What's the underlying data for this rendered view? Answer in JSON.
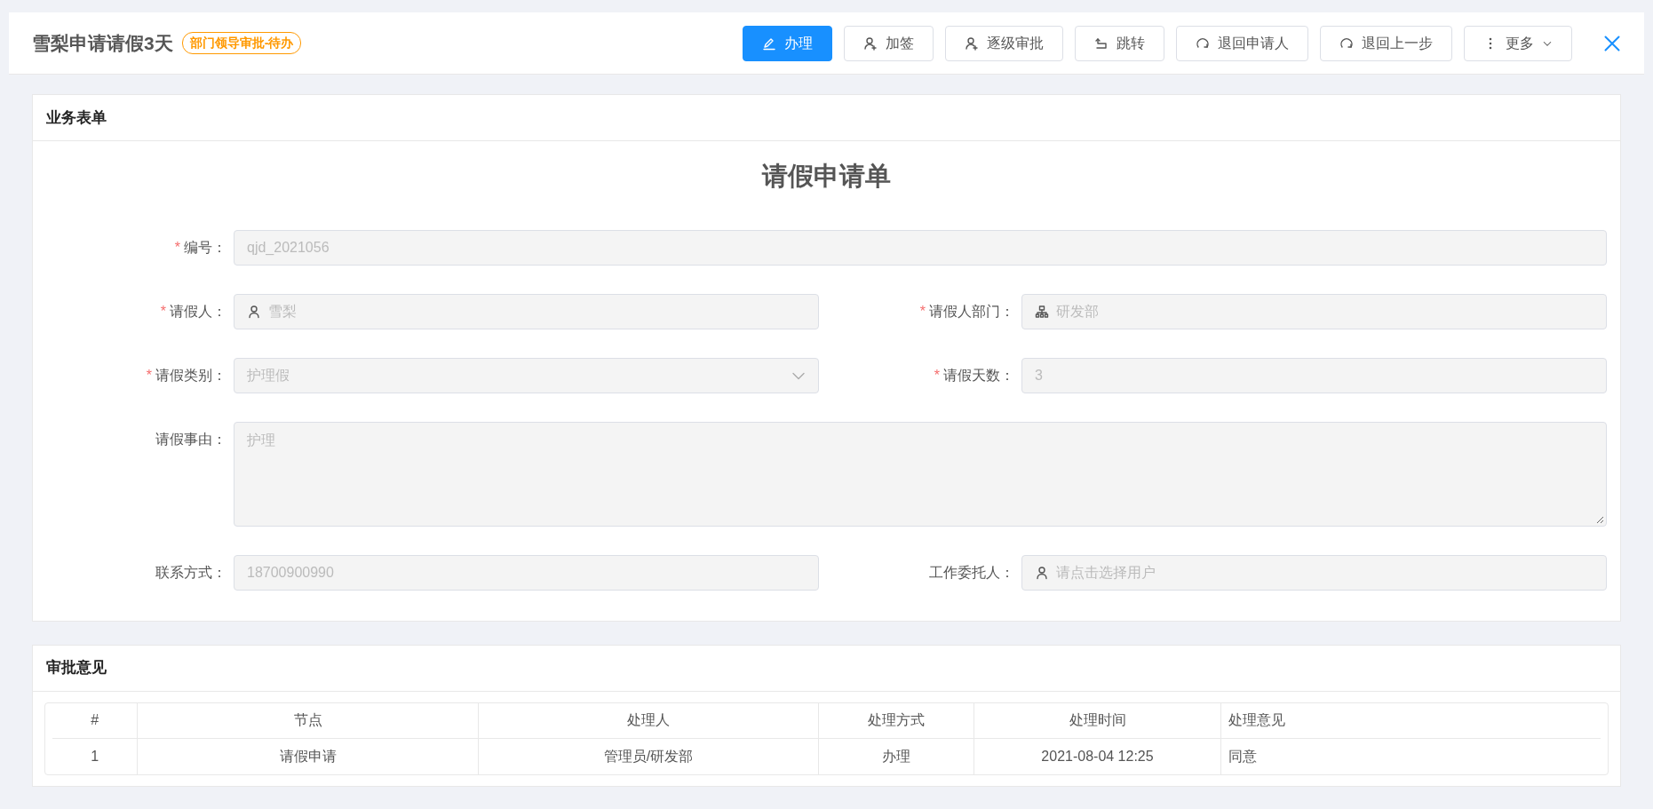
{
  "header": {
    "title": "雪梨申请请假3天",
    "status_badge": "部门领导审批-待办"
  },
  "toolbar": [
    {
      "label": "办理",
      "kind": "primary"
    },
    {
      "label": "加签",
      "kind": "default"
    },
    {
      "label": "逐级审批",
      "kind": "default"
    },
    {
      "label": "跳转",
      "kind": "default"
    },
    {
      "label": "退回申请人",
      "kind": "default"
    },
    {
      "label": "退回上一步",
      "kind": "default"
    },
    {
      "label": "更多",
      "kind": "default"
    }
  ],
  "business_form": {
    "card_title": "业务表单",
    "form_title": "请假申请单",
    "rows": [
      [
        {
          "required_mark": "*",
          "label": "编号：",
          "kind": "input",
          "value": "qjd_2021056",
          "disabled": true
        }
      ],
      [
        {
          "required_mark": "*",
          "label": "请假人：",
          "kind": "user",
          "value": "雪梨",
          "disabled": true
        },
        {
          "required_mark": "*",
          "label": "请假人部门：",
          "kind": "dept",
          "value": "研发部",
          "disabled": true
        }
      ],
      [
        {
          "required_mark": "*",
          "label": "请假类别：",
          "kind": "select",
          "value": "护理假",
          "disabled": true
        },
        {
          "required_mark": "*",
          "label": "请假天数：",
          "kind": "input",
          "value": "3",
          "disabled": true
        }
      ],
      [
        {
          "label": "请假事由：",
          "kind": "textarea",
          "value": "护理",
          "disabled": true
        }
      ],
      [
        {
          "label": "联系方式：",
          "kind": "input",
          "value": "18700900990",
          "disabled": true
        },
        {
          "label": "工作委托人：",
          "kind": "user",
          "placeholder": "请点击选择用户",
          "disabled": true
        }
      ]
    ]
  },
  "approval": {
    "card_title": "审批意见",
    "table": {
      "columns": [
        "#",
        "节点",
        "处理人",
        "处理方式",
        "处理时间",
        "处理意见"
      ],
      "rows": [
        [
          "1",
          "请假申请",
          "管理员/研发部",
          "办理",
          "2021-08-04 12:25",
          "同意"
        ]
      ]
    }
  }
}
